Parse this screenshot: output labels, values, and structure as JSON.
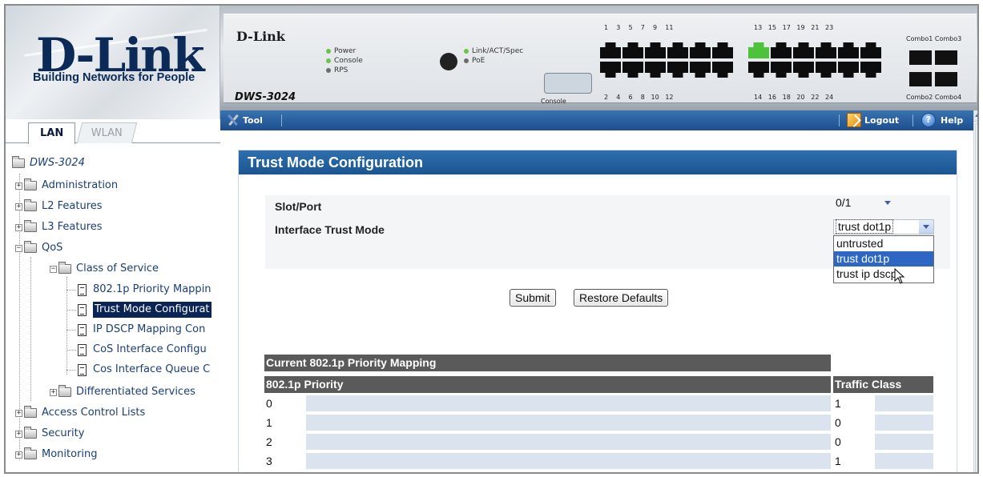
{
  "brand": {
    "logo_text": "D-Link",
    "tagline": "Building Networks for People",
    "device_brand": "D-Link",
    "model": "DWS-3024"
  },
  "device_panel": {
    "leds_left": [
      "Power",
      "Console",
      "RPS"
    ],
    "leds_right": [
      "Link/ACT/Spec",
      "PoE"
    ],
    "console_label": "Console",
    "top_port_numbers": "1    3    5    7    9    11",
    "top_port_numbers_2": "13   15   17   19   21   23",
    "bottom_port_numbers": "2    4    6    8   10   12",
    "bottom_port_numbers_2": "14   16   18   20   22   24",
    "combo_top": "Combo1 Combo3",
    "combo_bottom": "Combo2 Combo4"
  },
  "tabs": [
    {
      "label": "LAN",
      "active": true
    },
    {
      "label": "WLAN",
      "active": false
    }
  ],
  "tree": {
    "root": "DWS-3024",
    "items": [
      {
        "label": "Administration"
      },
      {
        "label": "L2 Features"
      },
      {
        "label": "L3 Features"
      },
      {
        "label": "QoS"
      },
      {
        "label": "Class of Service"
      },
      {
        "label": "802.1p Priority Mappin"
      },
      {
        "label": "Trust Mode Configurat"
      },
      {
        "label": "IP DSCP Mapping Con"
      },
      {
        "label": "CoS Interface Configu"
      },
      {
        "label": "Cos Interface Queue C"
      },
      {
        "label": "Differentiated Services"
      },
      {
        "label": "Access Control Lists"
      },
      {
        "label": "Security"
      },
      {
        "label": "Monitoring"
      }
    ]
  },
  "toolbar": {
    "tool": "Tool",
    "logout": "Logout",
    "help": "Help"
  },
  "page": {
    "title": "Trust Mode Configuration",
    "slot_port_label": "Slot/Port",
    "slot_port_value": "0/1",
    "trust_mode_label": "Interface Trust Mode",
    "trust_mode_value": "trust dot1p",
    "trust_mode_options": [
      "untrusted",
      "trust dot1p",
      "trust ip dscp"
    ],
    "submit": "Submit",
    "restore": "Restore Defaults"
  },
  "mapping_table": {
    "caption": "Current 802.1p Priority Mapping",
    "col_priority": "802.1p Priority",
    "col_class": "Traffic Class",
    "rows": [
      {
        "priority": "0",
        "class": "1"
      },
      {
        "priority": "1",
        "class": "0"
      },
      {
        "priority": "2",
        "class": "0"
      },
      {
        "priority": "3",
        "class": "1"
      }
    ]
  }
}
